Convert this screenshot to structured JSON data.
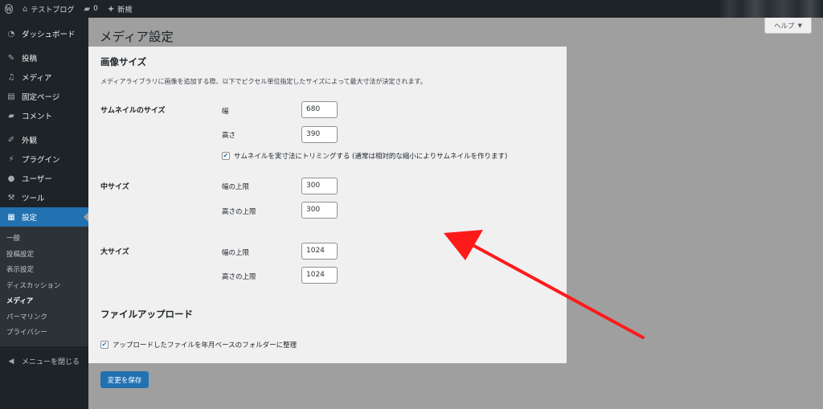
{
  "adminbar": {
    "site_name": "テストブログ",
    "comments_count": "0",
    "new_label": "新規"
  },
  "sidebar": {
    "items": [
      {
        "label": "ダッシュボード",
        "icon": "dashboard-icon"
      },
      {
        "label": "投稿",
        "icon": "pin-icon"
      },
      {
        "label": "メディア",
        "icon": "media-icon"
      },
      {
        "label": "固定ページ",
        "icon": "page-icon"
      },
      {
        "label": "コメント",
        "icon": "comment-icon"
      },
      {
        "label": "外観",
        "icon": "brush-icon"
      },
      {
        "label": "プラグイン",
        "icon": "plugin-icon"
      },
      {
        "label": "ユーザー",
        "icon": "user-icon"
      },
      {
        "label": "ツール",
        "icon": "wrench-icon"
      },
      {
        "label": "設定",
        "icon": "settings-icon"
      }
    ],
    "submenu": [
      "一般",
      "投稿設定",
      "表示設定",
      "ディスカッション",
      "メディア",
      "パーマリンク",
      "プライバシー"
    ],
    "submenu_active": "メディア",
    "collapse_label": "メニューを閉じる"
  },
  "help_label": "ヘルプ",
  "page_title": "メディア設定",
  "image_sizes": {
    "heading": "画像サイズ",
    "description": "メディアライブラリに画像を追加する際、以下でピクセル単位指定したサイズによって最大寸法が決定されます。",
    "thumbnail": {
      "label": "サムネイルのサイズ",
      "width_label": "幅",
      "width_value": "680",
      "height_label": "高さ",
      "height_value": "390",
      "crop_label": "サムネイルを実寸法にトリミングする (通常は相対的な縮小によりサムネイルを作ります)",
      "crop_checked": true
    },
    "medium": {
      "label": "中サイズ",
      "width_label": "幅の上限",
      "width_value": "300",
      "height_label": "高さの上限",
      "height_value": "300"
    },
    "large": {
      "label": "大サイズ",
      "width_label": "幅の上限",
      "width_value": "1024",
      "height_label": "高さの上限",
      "height_value": "1024"
    }
  },
  "uploads": {
    "heading": "ファイルアップロード",
    "organize_label": "アップロードしたファイルを年月ベースのフォルダーに整理",
    "organize_checked": true
  },
  "save_label": "変更を保存",
  "colors": {
    "accent": "#2271b1",
    "sidebar_bg": "#1d2327",
    "annotation_arrow": "#ff1a1a"
  }
}
